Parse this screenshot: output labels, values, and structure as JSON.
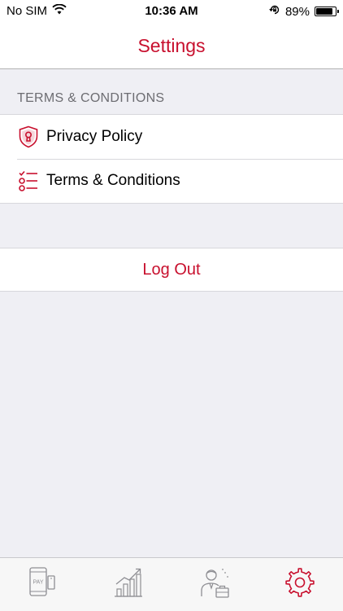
{
  "status_bar": {
    "carrier": "No SIM",
    "time": "10:36 AM",
    "battery_percent": "89%",
    "battery_level": 0.89,
    "icons": [
      "wifi-icon",
      "orientation-lock-icon",
      "battery-icon"
    ]
  },
  "nav": {
    "title": "Settings"
  },
  "section": {
    "header": "TERMS & CONDITIONS",
    "items": [
      {
        "label": "Privacy Policy",
        "icon": "shield-lock-icon"
      },
      {
        "label": "Terms & Conditions",
        "icon": "checklist-icon"
      }
    ]
  },
  "logout": {
    "label": "Log Out"
  },
  "tab_bar": {
    "items": [
      {
        "name": "pay",
        "icon": "phone-pay-icon",
        "icon_text": "PAY",
        "selected": false
      },
      {
        "name": "growth",
        "icon": "bar-chart-icon",
        "selected": false
      },
      {
        "name": "business",
        "icon": "businessman-icon",
        "selected": false
      },
      {
        "name": "settings",
        "icon": "gear-icon",
        "selected": true
      }
    ]
  },
  "colors": {
    "accent": "#c8102e",
    "background": "#efeff4",
    "inactive_icon": "#8e8e93"
  }
}
